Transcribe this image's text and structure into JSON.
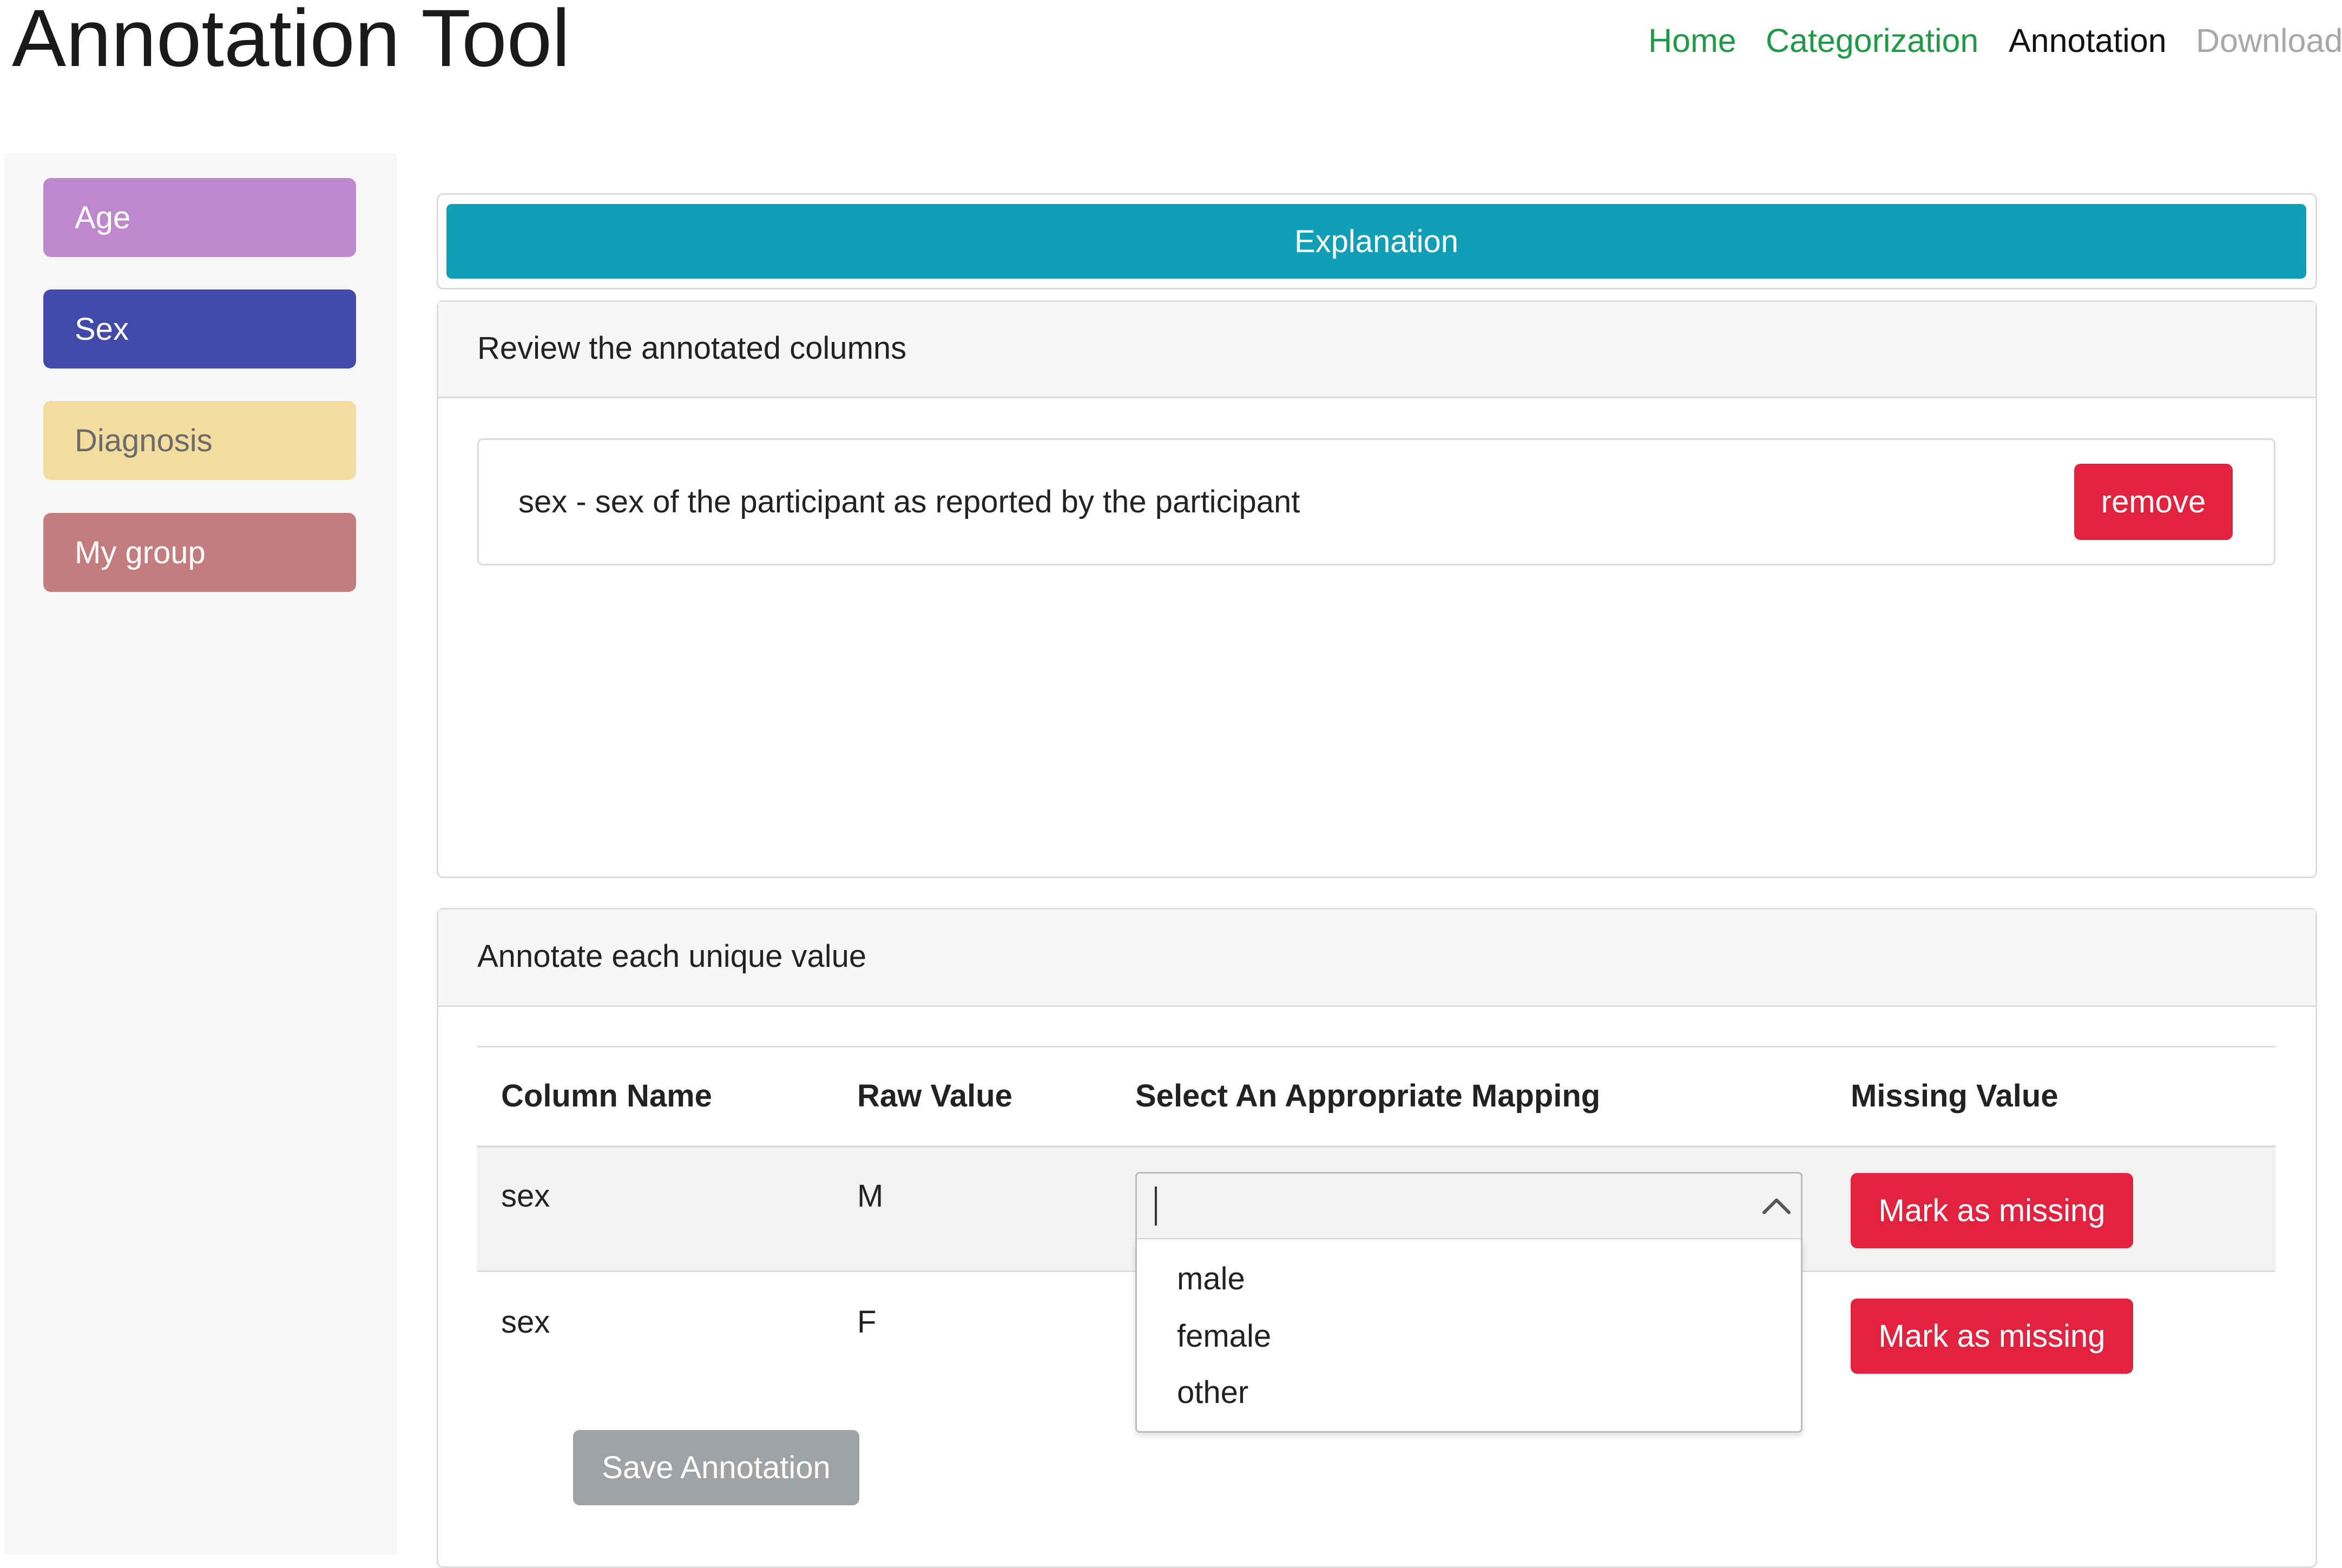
{
  "app": {
    "title": "Annotation Tool"
  },
  "nav": [
    {
      "label": "Home",
      "color": "#1f9a47"
    },
    {
      "label": "Categorization",
      "color": "#1f9a47"
    },
    {
      "label": "Annotation",
      "color": "#111111"
    },
    {
      "label": "Download",
      "color": "#a8a8a8"
    }
  ],
  "sidebar": {
    "groups": [
      {
        "label": "Age",
        "color": "#c088cc"
      },
      {
        "label": "Sex",
        "color": "#414aa8"
      },
      {
        "label": "Diagnosis",
        "color": "#f2dc9e"
      },
      {
        "label": "My group",
        "color": "#c47d7e"
      }
    ]
  },
  "explanation": {
    "label": "Explanation",
    "color": "#109fb6"
  },
  "review": {
    "header": "Review the annotated columns",
    "items": [
      {
        "text": "sex - sex of the participant as reported by the participant",
        "remove_label": "remove"
      }
    ]
  },
  "annotate": {
    "header": "Annotate each unique value",
    "columns": [
      "Column Name",
      "Raw Value",
      "Select An Appropriate Mapping",
      "Missing Value"
    ],
    "rows": [
      {
        "column": "sex",
        "raw": "M",
        "mapping": "",
        "missing_label": "Mark as missing"
      },
      {
        "column": "sex",
        "raw": "F",
        "mapping": "",
        "missing_label": "Mark as missing"
      }
    ],
    "dropdown_options": [
      "male",
      "female",
      "other"
    ],
    "save_label": "Save Annotation"
  }
}
